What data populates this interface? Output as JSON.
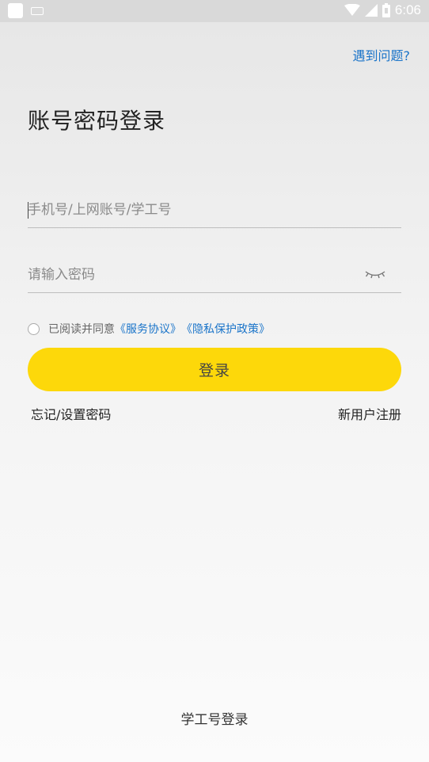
{
  "status_bar": {
    "time": "6:06",
    "icons": [
      "app-square-icon",
      "keyboard-icon",
      "wifi-icon",
      "signal-icon",
      "battery-icon"
    ]
  },
  "header": {
    "help_link": "遇到问题?"
  },
  "title": "账号密码登录",
  "form": {
    "account_placeholder": "手机号/上网账号/学工号",
    "password_placeholder": "请输入密码",
    "password_toggle_icon": "eye-closed-icon"
  },
  "agreement": {
    "prefix": "已阅读并同意",
    "service_link": "《服务协议》",
    "privacy_link": "《隐私保护政策》",
    "checked": false
  },
  "login_button": "登录",
  "links": {
    "forgot": "忘记/设置密码",
    "register": "新用户注册"
  },
  "bottom_link": "学工号登录",
  "colors": {
    "accent": "#fdd80a",
    "link": "#1a74c9"
  }
}
